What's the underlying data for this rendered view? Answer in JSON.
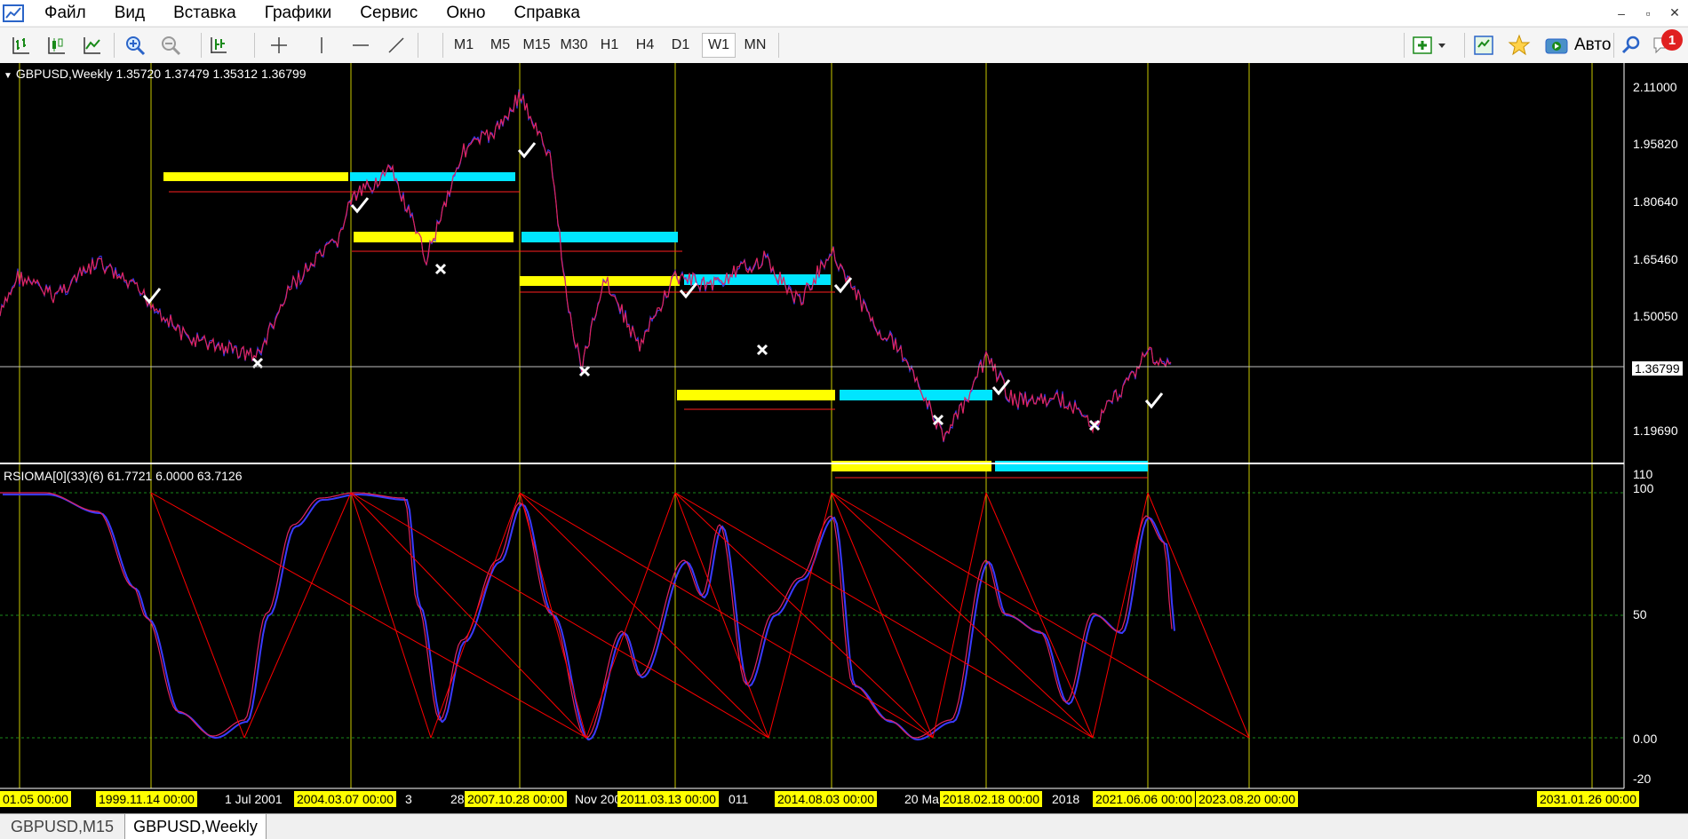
{
  "menu": {
    "items": [
      "Файл",
      "Вид",
      "Вставка",
      "Графики",
      "Сервис",
      "Окно",
      "Справка"
    ],
    "window_controls": [
      "–",
      "▫",
      "✕"
    ]
  },
  "toolbar": {
    "timeframes": [
      "M1",
      "M5",
      "M15",
      "M30",
      "H1",
      "H4",
      "D1",
      "W1",
      "MN"
    ],
    "active_timeframe": "W1",
    "auto_label": "Авто",
    "notification_count": "1",
    "icons": [
      "bar-chart-icon",
      "candlestick-icon",
      "line-chart-icon",
      "zoom-in-icon",
      "zoom-out-icon",
      "chart-shift-icon",
      "crosshair-icon",
      "vertical-line-icon",
      "horizontal-line-icon",
      "trendline-icon",
      "new-order-icon",
      "signals-icon",
      "favorites-icon",
      "auto-trading-icon",
      "search-icon",
      "chat-icon"
    ]
  },
  "chart": {
    "main_title": "GBPUSD,Weekly  1.35720 1.37479 1.35312 1.36799",
    "symbol": "GBPUSD",
    "period": "Weekly",
    "ohlc": {
      "open": "1.35720",
      "high": "1.37479",
      "low": "1.35312",
      "close": "1.36799"
    },
    "current_price": "1.36799",
    "price_scale": [
      "2.11000",
      "1.95820",
      "1.80640",
      "1.65460",
      "1.50050",
      "1.19690"
    ],
    "indicator_title": "RSIOMA[0](33)(6) 61.7721 6.0000 63.7126",
    "indicator_scale": [
      "110",
      "100",
      "50",
      "0.00",
      "-20"
    ],
    "date_labels": [
      {
        "text": "01.05 00:00",
        "highlighted": true
      },
      {
        "text": "1999.11.14 00:00",
        "highlighted": true
      },
      {
        "text": "1 Jul 2001",
        "highlighted": false
      },
      {
        "text": "2004.03.07 00:00",
        "highlighted": true
      },
      {
        "text": "3",
        "highlighted": false
      },
      {
        "text": "28",
        "highlighted": false
      },
      {
        "text": "2007.10.28 00:00",
        "highlighted": true
      },
      {
        "text": "Nov 200",
        "highlighted": false
      },
      {
        "text": "2011.03.13 00:00",
        "highlighted": true
      },
      {
        "text": "011",
        "highlighted": false
      },
      {
        "text": "2014.08.03 00:00",
        "highlighted": true
      },
      {
        "text": "20 Ma",
        "highlighted": false
      },
      {
        "text": "2018.02.18 00:00",
        "highlighted": true
      },
      {
        "text": "2018",
        "highlighted": false
      },
      {
        "text": "2021.06.06 00:00",
        "highlighted": true
      },
      {
        "text": "2023.08.20 00:00",
        "highlighted": true
      },
      {
        "text": "2031.01.26 00:00",
        "highlighted": true
      }
    ],
    "colors": {
      "background": "#000000",
      "price_line": "#e0245e",
      "price_line_alt": "#3a3aff",
      "vertical_lines": "#c8c800",
      "yellow_zone": "#ffff00",
      "cyan_zone": "#00e5ff",
      "zigzag": "#ff0000"
    }
  },
  "tabs": [
    {
      "label": "GBPUSD,M15",
      "active": false
    },
    {
      "label": "GBPUSD,Weekly",
      "active": true
    }
  ]
}
